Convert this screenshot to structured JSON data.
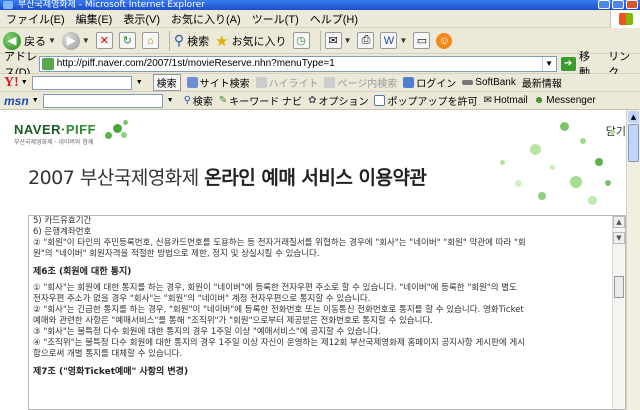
{
  "window": {
    "title": "부산국제영화제 - Microsoft Internet Explorer"
  },
  "menu": [
    "ファイル(E)",
    "編集(E)",
    "表示(V)",
    "お気に入り(A)",
    "ツール(T)",
    "ヘルプ(H)"
  ],
  "toolbar": {
    "back": "戻る",
    "search": "検索",
    "favorites": "お気に入り"
  },
  "address": {
    "label": "アドレス(D)",
    "url": "http://piff.naver.com/2007/1st/movieReserve.nhn?menuType=1",
    "go": "移動",
    "links": "リンク"
  },
  "yahoo": {
    "search": "検索",
    "site_search": "サイト検索",
    "highlight": "ハイライト",
    "page_search": "ページ内検索",
    "login": "ログイン",
    "softbank": "SoftBank",
    "news": "最新情報"
  },
  "msn": {
    "logo": "msn",
    "search": "検索",
    "keyword": "キーワード ナビ",
    "options": "オプション",
    "popup": "ポップアップを許可",
    "hotmail": "Hotmail",
    "messenger": "Messenger"
  },
  "site": {
    "logo_naver": "NAVER",
    "logo_dot": "·",
    "logo_piff": "PIFF",
    "logo_sub": "부산국제영화제 · 네이버와 함께",
    "close": "닫기",
    "headline_plain": "2007 부산국제영화제 ",
    "headline_bold": "온라인 예매 서비스 이용약관"
  },
  "terms": {
    "lines_top": [
      "5) 카드유효기간",
      "6) 은행계좌번호",
      "② \"회원\"이 타인의 주민등록번호, 신용카드번호를 도용하는 등 전자거래질서를 위협하는 경우에 \"회사\"는 \"네이버\" \"회원\" 약관에 따라 \"회",
      "원\"의 \"네이버\" 회원자격을 적절한 방법으로 제한, 정지 및 상실시킬 수 있습니다."
    ],
    "sec6_title": "제6조 (회원에 대한 통지)",
    "sec6_lines": [
      "① \"회사\"는 회원에 대한 통지를 하는 경우, 회원이 \"네이버\"에 등록한 전자우편 주소로 할 수 있습니다. \"네이버\"에 등록한 \"회원\"의 별도",
      "전자우편 주소가 없을 경우 \"회사\"는 \"회원\"의 \"네이버\" 계정 전자우편으로 통지할 수 있습니다.",
      "② \"회사\"는 긴급한 통지를 하는 경우, \"회원\"이 \"네이버\"에 등록한 전화번호 또는 이동통신 전화번호로 통지를 할 수 있습니다. 영화Ticket",
      "예매와 관련한 사항은 \"예매서비스\"를 통해 \"조직위\"가 \"회원\"으로부터 제공받은 전화번호로 통지할 수 있습니다.",
      "③ \"회사\"는 불특정 다수 회원에 대한 통지의 경우 1주일 이상 \"예매서비스\"에 공지할 수 있습니다.",
      "④ \"조직위\"는 불특정 다수 회원에 대한 통지의 경우 1주일 이상 자신이 운영하는 제12회 부산국제영화제 홈페이지 공지사항 게시판에 게시",
      "함으로써 개별 통지를 대체할 수 있습니다."
    ],
    "sec7_title": "제7조 (\"영화Ticket예매\" 사항의 변경)"
  },
  "colors": {
    "accent_green": "#2c8a2f",
    "title_blue": "#1b4fc9"
  }
}
